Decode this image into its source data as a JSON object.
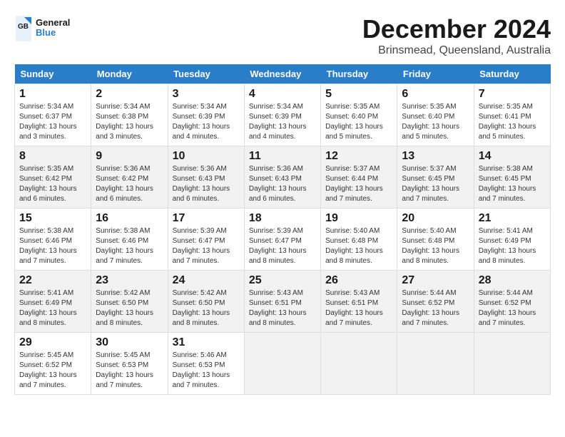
{
  "logo": {
    "line1": "General",
    "line2": "Blue"
  },
  "title": "December 2024",
  "subtitle": "Brinsmead, Queensland, Australia",
  "headers": [
    "Sunday",
    "Monday",
    "Tuesday",
    "Wednesday",
    "Thursday",
    "Friday",
    "Saturday"
  ],
  "weeks": [
    [
      {
        "day": "1",
        "sunrise": "5:34 AM",
        "sunset": "6:37 PM",
        "daylight": "13 hours and 3 minutes."
      },
      {
        "day": "2",
        "sunrise": "5:34 AM",
        "sunset": "6:38 PM",
        "daylight": "13 hours and 3 minutes."
      },
      {
        "day": "3",
        "sunrise": "5:34 AM",
        "sunset": "6:39 PM",
        "daylight": "13 hours and 4 minutes."
      },
      {
        "day": "4",
        "sunrise": "5:34 AM",
        "sunset": "6:39 PM",
        "daylight": "13 hours and 4 minutes."
      },
      {
        "day": "5",
        "sunrise": "5:35 AM",
        "sunset": "6:40 PM",
        "daylight": "13 hours and 5 minutes."
      },
      {
        "day": "6",
        "sunrise": "5:35 AM",
        "sunset": "6:40 PM",
        "daylight": "13 hours and 5 minutes."
      },
      {
        "day": "7",
        "sunrise": "5:35 AM",
        "sunset": "6:41 PM",
        "daylight": "13 hours and 5 minutes."
      }
    ],
    [
      {
        "day": "8",
        "sunrise": "5:35 AM",
        "sunset": "6:42 PM",
        "daylight": "13 hours and 6 minutes."
      },
      {
        "day": "9",
        "sunrise": "5:36 AM",
        "sunset": "6:42 PM",
        "daylight": "13 hours and 6 minutes."
      },
      {
        "day": "10",
        "sunrise": "5:36 AM",
        "sunset": "6:43 PM",
        "daylight": "13 hours and 6 minutes."
      },
      {
        "day": "11",
        "sunrise": "5:36 AM",
        "sunset": "6:43 PM",
        "daylight": "13 hours and 6 minutes."
      },
      {
        "day": "12",
        "sunrise": "5:37 AM",
        "sunset": "6:44 PM",
        "daylight": "13 hours and 7 minutes."
      },
      {
        "day": "13",
        "sunrise": "5:37 AM",
        "sunset": "6:45 PM",
        "daylight": "13 hours and 7 minutes."
      },
      {
        "day": "14",
        "sunrise": "5:38 AM",
        "sunset": "6:45 PM",
        "daylight": "13 hours and 7 minutes."
      }
    ],
    [
      {
        "day": "15",
        "sunrise": "5:38 AM",
        "sunset": "6:46 PM",
        "daylight": "13 hours and 7 minutes."
      },
      {
        "day": "16",
        "sunrise": "5:38 AM",
        "sunset": "6:46 PM",
        "daylight": "13 hours and 7 minutes."
      },
      {
        "day": "17",
        "sunrise": "5:39 AM",
        "sunset": "6:47 PM",
        "daylight": "13 hours and 7 minutes."
      },
      {
        "day": "18",
        "sunrise": "5:39 AM",
        "sunset": "6:47 PM",
        "daylight": "13 hours and 8 minutes."
      },
      {
        "day": "19",
        "sunrise": "5:40 AM",
        "sunset": "6:48 PM",
        "daylight": "13 hours and 8 minutes."
      },
      {
        "day": "20",
        "sunrise": "5:40 AM",
        "sunset": "6:48 PM",
        "daylight": "13 hours and 8 minutes."
      },
      {
        "day": "21",
        "sunrise": "5:41 AM",
        "sunset": "6:49 PM",
        "daylight": "13 hours and 8 minutes."
      }
    ],
    [
      {
        "day": "22",
        "sunrise": "5:41 AM",
        "sunset": "6:49 PM",
        "daylight": "13 hours and 8 minutes."
      },
      {
        "day": "23",
        "sunrise": "5:42 AM",
        "sunset": "6:50 PM",
        "daylight": "13 hours and 8 minutes."
      },
      {
        "day": "24",
        "sunrise": "5:42 AM",
        "sunset": "6:50 PM",
        "daylight": "13 hours and 8 minutes."
      },
      {
        "day": "25",
        "sunrise": "5:43 AM",
        "sunset": "6:51 PM",
        "daylight": "13 hours and 8 minutes."
      },
      {
        "day": "26",
        "sunrise": "5:43 AM",
        "sunset": "6:51 PM",
        "daylight": "13 hours and 7 minutes."
      },
      {
        "day": "27",
        "sunrise": "5:44 AM",
        "sunset": "6:52 PM",
        "daylight": "13 hours and 7 minutes."
      },
      {
        "day": "28",
        "sunrise": "5:44 AM",
        "sunset": "6:52 PM",
        "daylight": "13 hours and 7 minutes."
      }
    ],
    [
      {
        "day": "29",
        "sunrise": "5:45 AM",
        "sunset": "6:52 PM",
        "daylight": "13 hours and 7 minutes."
      },
      {
        "day": "30",
        "sunrise": "5:45 AM",
        "sunset": "6:53 PM",
        "daylight": "13 hours and 7 minutes."
      },
      {
        "day": "31",
        "sunrise": "5:46 AM",
        "sunset": "6:53 PM",
        "daylight": "13 hours and 7 minutes."
      },
      null,
      null,
      null,
      null
    ]
  ],
  "labels": {
    "sunrise": "Sunrise:",
    "sunset": "Sunset:",
    "daylight": "Daylight:"
  }
}
